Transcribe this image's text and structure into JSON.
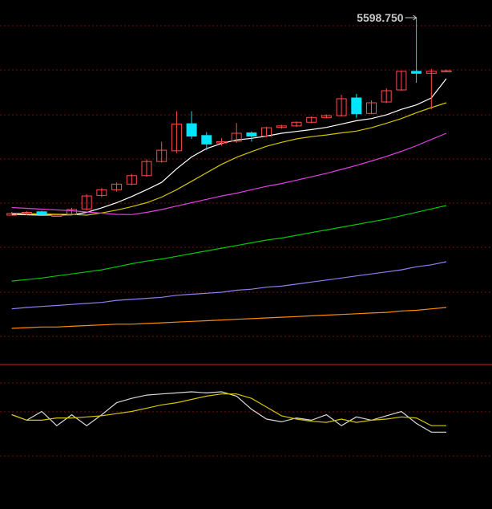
{
  "chart_data": {
    "type": "candlestick",
    "annotation": {
      "label": "5598.750",
      "value": 5598.75
    },
    "price_axis": {
      "min": 4020,
      "max": 5680
    },
    "candles": [
      {
        "o": 4350,
        "c": 4356,
        "h": 4362,
        "l": 4344
      },
      {
        "o": 4356,
        "c": 4360,
        "h": 4364,
        "l": 4350
      },
      {
        "o": 4362,
        "c": 4344,
        "h": 4366,
        "l": 4340
      },
      {
        "o": 4346,
        "c": 4350,
        "h": 4356,
        "l": 4342
      },
      {
        "o": 4352,
        "c": 4370,
        "h": 4376,
        "l": 4348
      },
      {
        "o": 4372,
        "c": 4418,
        "h": 4424,
        "l": 4366
      },
      {
        "o": 4420,
        "c": 4440,
        "h": 4446,
        "l": 4414
      },
      {
        "o": 4440,
        "c": 4460,
        "h": 4466,
        "l": 4434
      },
      {
        "o": 4460,
        "c": 4490,
        "h": 4496,
        "l": 4456
      },
      {
        "o": 4490,
        "c": 4540,
        "h": 4548,
        "l": 4486
      },
      {
        "o": 4540,
        "c": 4580,
        "h": 4610,
        "l": 4536
      },
      {
        "o": 4578,
        "c": 4690,
        "h": 4760,
        "l": 4570
      },
      {
        "o": 4692,
        "c": 4630,
        "h": 4760,
        "l": 4620
      },
      {
        "o": 4632,
        "c": 4602,
        "h": 4646,
        "l": 4580
      },
      {
        "o": 4610,
        "c": 4610,
        "h": 4622,
        "l": 4596
      },
      {
        "o": 4612,
        "c": 4640,
        "h": 4696,
        "l": 4606
      },
      {
        "o": 4642,
        "c": 4630,
        "h": 4650,
        "l": 4610
      },
      {
        "o": 4630,
        "c": 4670,
        "h": 4676,
        "l": 4626
      },
      {
        "o": 4672,
        "c": 4680,
        "h": 4686,
        "l": 4664
      },
      {
        "o": 4680,
        "c": 4700,
        "h": 4704,
        "l": 4674
      },
      {
        "o": 4700,
        "c": 4726,
        "h": 4732,
        "l": 4694
      },
      {
        "o": 4726,
        "c": 4736,
        "h": 4742,
        "l": 4722
      },
      {
        "o": 4736,
        "c": 4816,
        "h": 4826,
        "l": 4732
      },
      {
        "o": 4818,
        "c": 4746,
        "h": 4828,
        "l": 4724
      },
      {
        "o": 4748,
        "c": 4806,
        "h": 4812,
        "l": 4744
      },
      {
        "o": 4808,
        "c": 4836,
        "h": 4842,
        "l": 4804
      },
      {
        "o": 4838,
        "c": 4976,
        "h": 4982,
        "l": 4836
      },
      {
        "o": 4976,
        "c": 4946,
        "h": 5598.75,
        "l": 4856
      },
      {
        "o": 4946,
        "c": 4976,
        "h": 5006,
        "l": 4770
      },
      {
        "o": 4976,
        "c": 4986,
        "h": 4998,
        "l": 4970
      }
    ],
    "moving_averages": [
      {
        "color": "#ffffff",
        "values": [
          4346,
          4348,
          4350,
          4349,
          4351,
          4360,
          4376,
          4394,
          4416,
          4440,
          4466,
          4514,
          4556,
          4586,
          4604,
          4616,
          4622,
          4630,
          4640,
          4650,
          4660,
          4672,
          4690,
          4708,
          4720,
          4740,
          4770,
          4794,
          4818,
          4866
        ]
      },
      {
        "color": "#d4c400",
        "values": [
          4340,
          4342,
          4344,
          4345,
          4346,
          4350,
          4358,
          4368,
          4380,
          4394,
          4414,
          4440,
          4470,
          4500,
          4530,
          4555,
          4575,
          4594,
          4608,
          4620,
          4628,
          4634,
          4642,
          4652,
          4670,
          4694,
          4720,
          4752,
          4780,
          4806
        ]
      },
      {
        "color": "#e040e0",
        "values": [
          4312,
          4316,
          4320,
          4324,
          4328,
          4334,
          4340,
          4346,
          4352,
          4360,
          4370,
          4382,
          4394,
          4406,
          4418,
          4428,
          4440,
          4452,
          4462,
          4474,
          4486,
          4498,
          4512,
          4526,
          4542,
          4558,
          4576,
          4596,
          4618,
          4640
        ]
      },
      {
        "color": "#00c800",
        "values": [
          4098,
          4101,
          4104,
          4108,
          4112,
          4116,
          4120,
          4126,
          4132,
          4138,
          4144,
          4152,
          4160,
          4168,
          4176,
          4184,
          4192,
          4200,
          4206,
          4214,
          4222,
          4230,
          4238,
          4246,
          4254,
          4262,
          4272,
          4282,
          4292,
          4302
        ]
      },
      {
        "color": "#8f7ff0",
        "values": [
          4044,
          4046,
          4048,
          4050,
          4052,
          4054,
          4056,
          4060,
          4062,
          4064,
          4066,
          4070,
          4072,
          4074,
          4076,
          4080,
          4082,
          4086,
          4088,
          4092,
          4096,
          4100,
          4104,
          4108,
          4112,
          4116,
          4120,
          4126,
          4130,
          4136
        ]
      },
      {
        "color": "#ff8a00",
        "values": [
          4016,
          4017,
          4018,
          4018,
          4019,
          4020,
          4021,
          4022,
          4022,
          4023,
          4024,
          4025,
          4026,
          4027,
          4028,
          4029,
          4030,
          4031,
          4032,
          4033,
          4034,
          4035,
          4036,
          4037,
          4038,
          4039,
          4041,
          4042,
          4044,
          4046
        ]
      }
    ],
    "oscillator": {
      "range": [
        0,
        100
      ],
      "lines": [
        {
          "color": "#d8d8d8",
          "values": [
            58,
            48,
            64,
            38,
            58,
            38,
            58,
            80,
            88,
            94,
            96,
            98,
            100,
            98,
            100,
            92,
            68,
            50,
            45,
            52,
            48,
            58,
            38,
            54,
            48,
            56,
            64,
            42,
            26,
            26
          ]
        },
        {
          "color": "#d4c400",
          "values": [
            58,
            48,
            48,
            52,
            52,
            54,
            56,
            60,
            64,
            70,
            76,
            80,
            86,
            92,
            96,
            96,
            88,
            72,
            56,
            50,
            46,
            44,
            50,
            44,
            48,
            50,
            54,
            52,
            38,
            38
          ]
        }
      ]
    }
  }
}
